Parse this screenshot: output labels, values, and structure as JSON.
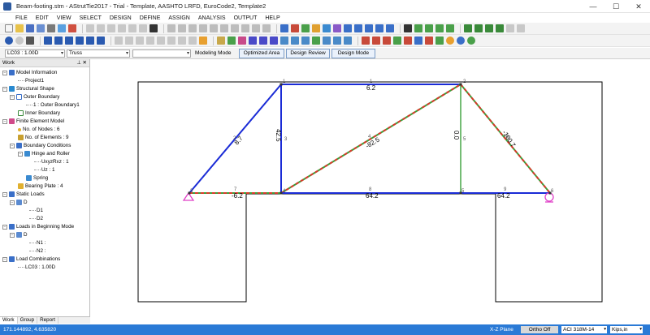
{
  "window": {
    "title": "Beam-footing.stm - AStrutTie2017 - Trial - Template, AASHTO LRFD, EuroCode2, Template2",
    "min_glyph": "—",
    "max_glyph": "☐",
    "close_glyph": "✕"
  },
  "menu": [
    "FILE",
    "EDIT",
    "VIEW",
    "SELECT",
    "DESIGN",
    "DEFINE",
    "ASSIGN",
    "ANALYSIS",
    "OUTPUT",
    "HELP"
  ],
  "mode_row": {
    "load_case": "LC03 : 1.00D",
    "element_type": "Truss",
    "empty_combo": "",
    "modeling_label": "Modeling Mode",
    "optimized_area": "Optimized Area",
    "design_review": "Design Review",
    "design_mode": "Design Mode",
    "dropdown_glyph": "▾"
  },
  "work_panel": {
    "header": "Work",
    "pin_glyph": "📌",
    "close_glyph": "✕",
    "tabs": [
      "Work",
      "Group",
      "Report"
    ],
    "items": {
      "model_information": "Model Information",
      "project1": "Project1",
      "structural_shape": "Structural Shape",
      "outer_boundary": "Outer Boundary",
      "outer_boundary1": "1 : Outer Boundary1",
      "inner_boundary": "Inner Boundary",
      "finite_element_model": "Finite Element Model",
      "no_of_nodes": "No. of Nodes : 6",
      "no_of_elements": "No. of Elements : 9",
      "boundary_conditions": "Boundary Conditions",
      "hinge_and_roller": "Hinge and Roller",
      "uxyzrxz": "UxyzRxz : 1",
      "uz": "Uz : 1",
      "spring": "Spring",
      "bearing_plate": "Bearing Plate : 4",
      "static_loads": "Static Loads",
      "static_d": "D",
      "d1": "D1",
      "d2": "D2",
      "loads_beginning_mode": "Loads in Beginning Mode",
      "beginning_d": "D",
      "n1": "N1 :",
      "n2": "N2 :",
      "load_combinations": "Load Combinations",
      "lc03": "LC03 : 1.00D"
    }
  },
  "model": {
    "nodes": [
      {
        "id": "1",
        "label": "1"
      },
      {
        "id": "2",
        "label": "2"
      },
      {
        "id": "3",
        "label": "3"
      },
      {
        "id": "4",
        "label": "4"
      },
      {
        "id": "5",
        "label": "5"
      },
      {
        "id": "6",
        "label": "6"
      }
    ],
    "members": [
      {
        "id": "1",
        "force": "6.2",
        "kind": "tension"
      },
      {
        "id": "2",
        "force": "8.7",
        "kind": "tension"
      },
      {
        "id": "3",
        "force": "42.5",
        "kind": "tension"
      },
      {
        "id": "4",
        "force": "-82.5",
        "kind": "compression"
      },
      {
        "id": "5",
        "force": "0.0",
        "kind": "zero"
      },
      {
        "id": "6",
        "force": "-100.7",
        "kind": "compression"
      },
      {
        "id": "7",
        "force": "-6.2",
        "kind": "compression"
      },
      {
        "id": "8",
        "force": "64.2",
        "kind": "tension"
      },
      {
        "id": "9",
        "force": "64.2",
        "kind": "tension"
      }
    ],
    "colors": {
      "tension": "#1a2bd6",
      "compression_fill": "#3aa03a",
      "compression_dash": "#d83a2a",
      "zero": "#3aa03a",
      "support": "#e040c8"
    }
  },
  "status": {
    "coords": "171.144892, 4.635820",
    "plane": "X-Z Plane",
    "ortho": "Ortho Off",
    "code": "ACI 318M-14",
    "units": "Kips,in",
    "dropdown_glyph": "▾"
  }
}
